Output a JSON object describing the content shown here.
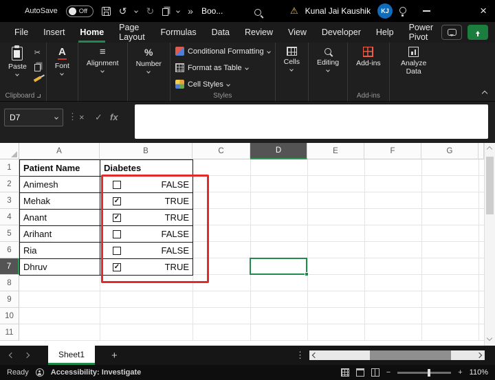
{
  "title_bar": {
    "autosave_label": "AutoSave",
    "autosave_state": "Off",
    "workbook_name": "Boo...",
    "user_name": "Kunal Jai Kaushik",
    "user_initials": "KJ"
  },
  "menu": {
    "items": [
      "File",
      "Insert",
      "Home",
      "Page Layout",
      "Formulas",
      "Data",
      "Review",
      "View",
      "Developer",
      "Help",
      "Power Pivot"
    ],
    "active_item": "Home"
  },
  "ribbon": {
    "paste": "Paste",
    "font": "Font",
    "alignment": "Alignment",
    "number": "Number",
    "conditional_formatting": "Conditional Formatting",
    "format_as_table": "Format as Table",
    "cell_styles": "Cell Styles",
    "cells": "Cells",
    "editing": "Editing",
    "addins": "Add-ins",
    "analyze_data": "Analyze Data",
    "groups": {
      "clipboard": "Clipboard",
      "styles": "Styles",
      "addins": "Add-ins"
    }
  },
  "formula_bar": {
    "name_box": "D7",
    "fx": "fx",
    "formula": ""
  },
  "sheet": {
    "columns": [
      "A",
      "B",
      "C",
      "D",
      "E",
      "F",
      "G"
    ],
    "selected_column": "D",
    "rows": [
      "1",
      "2",
      "3",
      "4",
      "5",
      "6",
      "7",
      "8",
      "9",
      "10",
      "11"
    ],
    "selected_row": "7",
    "selected_cell": "D7",
    "table": {
      "header_name": "Patient Name",
      "header_diabetes": "Diabetes",
      "rows": [
        {
          "name": "Animesh",
          "checked": false,
          "value": "FALSE"
        },
        {
          "name": "Mehak",
          "checked": true,
          "value": "TRUE"
        },
        {
          "name": "Anant",
          "checked": true,
          "value": "TRUE"
        },
        {
          "name": "Arihant",
          "checked": false,
          "value": "FALSE"
        },
        {
          "name": "Ria",
          "checked": false,
          "value": "FALSE"
        },
        {
          "name": "Dhruv",
          "checked": true,
          "value": "TRUE"
        }
      ]
    }
  },
  "sheet_tabs": {
    "active_tab": "Sheet1"
  },
  "status_bar": {
    "mode": "Ready",
    "accessibility": "Accessibility: Investigate",
    "zoom": "110%"
  },
  "icons": {
    "cut": "✂",
    "undo": "↺",
    "redo": "↻",
    "overflow": "»",
    "warning": "⚠",
    "close": "×",
    "dots_vertical": "⋮",
    "cancel": "×",
    "enter": "✓",
    "percent": "%",
    "font_letter": "A",
    "alignment_lines": "≡",
    "minus": "−",
    "plus": "+",
    "add_sheet": "+"
  },
  "colors": {
    "accent_green": "#107C41",
    "annotation_red": "#E02B2B",
    "addins_red": "#E8604A",
    "warning_yellow": "#F2C744",
    "user_badge_blue": "#0F6CBD"
  }
}
